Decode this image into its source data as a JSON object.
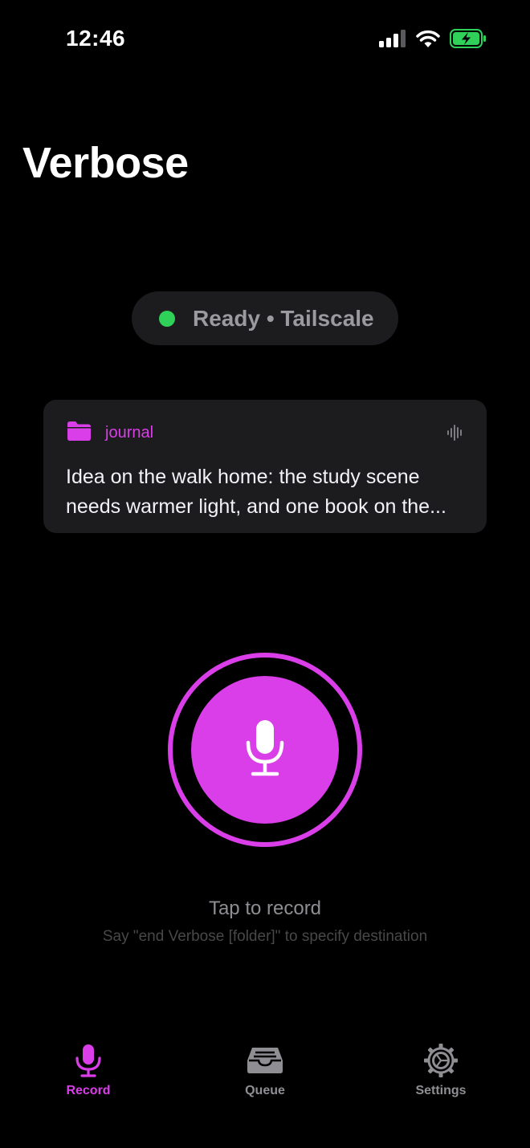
{
  "status_bar": {
    "time": "12:46",
    "icons": [
      "cellular-signal-icon",
      "wifi-icon",
      "battery-charging-icon"
    ]
  },
  "app": {
    "title": "Verbose"
  },
  "connection": {
    "status_text": "Ready • Tailscale",
    "status_color": "#30d158"
  },
  "recent_recording": {
    "folder": "journal",
    "text_line1": "Idea on the walk home: the study scene",
    "text_line2": "needs warmer light, and one book on the..."
  },
  "record": {
    "hint": "Tap to record",
    "subhint": "Say \"end Verbose [folder]\" to specify destination"
  },
  "tabs": [
    {
      "label": "Record",
      "icon": "microphone-icon",
      "active": true
    },
    {
      "label": "Queue",
      "icon": "tray-icon",
      "active": false
    },
    {
      "label": "Settings",
      "icon": "gear-icon",
      "active": false
    }
  ],
  "colors": {
    "accent": "#d93ee8",
    "background": "#000000",
    "card": "#1c1c1e",
    "ready": "#30d158"
  }
}
